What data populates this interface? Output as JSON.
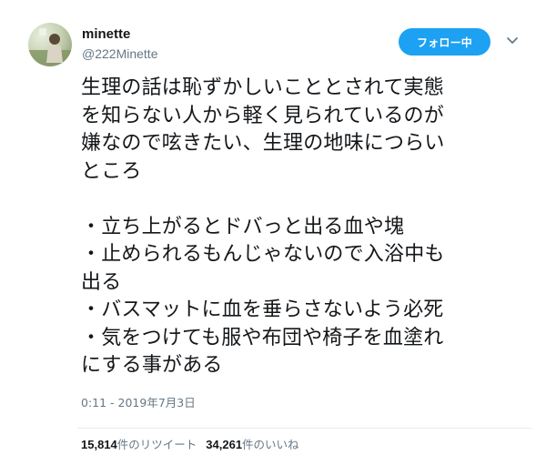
{
  "user": {
    "display_name": "minette",
    "handle": "@222Minette"
  },
  "follow_button": {
    "label": "フォロー中"
  },
  "tweet": {
    "text": "生理の話は恥ずかしいこととされて実態\nを知らない人から軽く見られているのが\n嫌なので呟きたい、生理の地味につらい\nところ\n\n・立ち上がるとドバっと出る血や塊\n・止められるもんじゃないので入浴中も\n出る\n・バスマットに血を垂らさないよう必死\n・気をつけても服や布団や椅子を血塗れ\nにする事がある",
    "timestamp": "0:11 - 2019年7月3日"
  },
  "stats": {
    "retweets_count": "15,814",
    "retweets_label": "件のリツイート",
    "likes_count": "34,261",
    "likes_label": "件のいいね"
  },
  "colors": {
    "accent": "#1da1f2",
    "text": "#14171a",
    "muted": "#657786",
    "divider": "#e6ecf0"
  },
  "icons": {
    "menu": "chevron-down-icon"
  }
}
